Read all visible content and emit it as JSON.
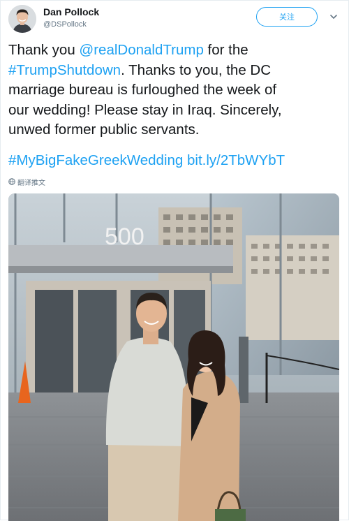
{
  "author": {
    "name": "Dan Pollock",
    "handle": "@DSPollock"
  },
  "follow_button": {
    "label": "关注"
  },
  "tweet": {
    "lines": [
      [
        {
          "t": "Thank you "
        },
        {
          "t": "@realDonaldTrump",
          "link": true
        },
        {
          "t": " for the"
        }
      ],
      [
        {
          "t": "#TrumpShutdown",
          "link": true
        },
        {
          "t": ". Thanks to you, the DC"
        }
      ],
      [
        {
          "t": "marriage bureau is furloughed the week of"
        }
      ],
      [
        {
          "t": "our wedding! Please stay in Iraq. Sincerely,"
        }
      ],
      [
        {
          "t": "unwed former public servants."
        }
      ],
      [],
      [
        {
          "t": "#MyBigFakeGreekWedding",
          "link": true
        },
        {
          "t": " "
        },
        {
          "t": "bit.ly/2TbWYbT",
          "link": true
        }
      ]
    ]
  },
  "translate": {
    "icon": "globe-icon",
    "label": "翻译推文"
  },
  "photo": {
    "building_number": "500",
    "description_icon": "photo"
  },
  "colors": {
    "link": "#1da1f2",
    "text": "#14171a",
    "secondary": "#657786"
  }
}
